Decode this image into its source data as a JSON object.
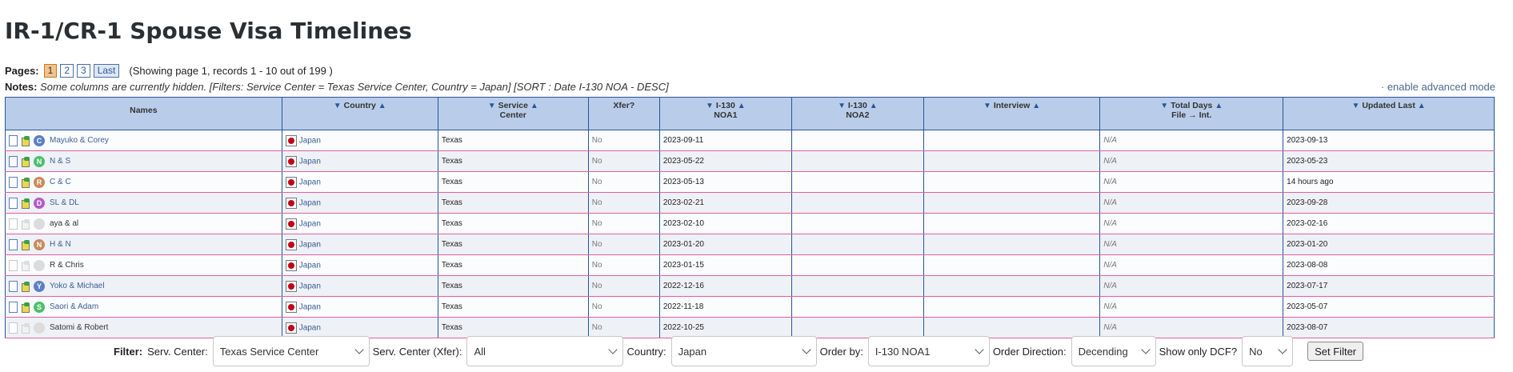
{
  "title": "IR-1/CR-1 Spouse Visa Timelines",
  "pager": {
    "label": "Pages:",
    "pages": [
      "1",
      "2",
      "3"
    ],
    "last": "Last",
    "info": "(Showing page 1, records 1 - 10 out of 199 )"
  },
  "notes": {
    "label": "Notes:",
    "text": "Some columns are currently hidden. [Filters: Service Center = Texas Service Center, Country = Japan] [SORT : Date I-130 NOA - DESC]"
  },
  "advanced_link": "· enable advanced mode",
  "columns": {
    "names": "Names",
    "country": "Country",
    "service_center_1": "Service",
    "service_center_2": "Center",
    "xfer": "Xfer?",
    "i130_noa1_1": "I-130",
    "i130_noa1_2": "NOA1",
    "i130_noa2_1": "I-130",
    "i130_noa2_2": "NOA2",
    "interview": "Interview",
    "total_days_1": "Total Days",
    "total_days_2": "File → Int.",
    "updated_last": "Updated Last"
  },
  "rows": [
    {
      "initial": "C",
      "avatar_color": "#5b7fc7",
      "name": "Mayuko & Corey",
      "active": true,
      "country": "Japan",
      "service_center": "Texas",
      "xfer": "No",
      "noa1": "2023-09-11",
      "noa2": "",
      "interview": "",
      "total_days": "N/A",
      "updated": "2023-09-13"
    },
    {
      "initial": "N",
      "avatar_color": "#4cbf6a",
      "name": "N & S",
      "active": true,
      "country": "Japan",
      "service_center": "Texas",
      "xfer": "No",
      "noa1": "2023-05-22",
      "noa2": "",
      "interview": "",
      "total_days": "N/A",
      "updated": "2023-05-23"
    },
    {
      "initial": "R",
      "avatar_color": "#c98a5a",
      "name": "C & C",
      "active": true,
      "country": "Japan",
      "service_center": "Texas",
      "xfer": "No",
      "noa1": "2023-05-13",
      "noa2": "",
      "interview": "",
      "total_days": "N/A",
      "updated": "14 hours ago"
    },
    {
      "initial": "D",
      "avatar_color": "#b45cc7",
      "name": "SL & DL",
      "active": true,
      "country": "Japan",
      "service_center": "Texas",
      "xfer": "No",
      "noa1": "2023-02-21",
      "noa2": "",
      "interview": "",
      "total_days": "N/A",
      "updated": "2023-09-28"
    },
    {
      "initial": "",
      "avatar_color": "",
      "name": "aya & al",
      "active": false,
      "country": "Japan",
      "service_center": "Texas",
      "xfer": "No",
      "noa1": "2023-02-10",
      "noa2": "",
      "interview": "",
      "total_days": "N/A",
      "updated": "2023-02-16"
    },
    {
      "initial": "N",
      "avatar_color": "#c98a5a",
      "name": "H & N",
      "active": true,
      "country": "Japan",
      "service_center": "Texas",
      "xfer": "No",
      "noa1": "2023-01-20",
      "noa2": "",
      "interview": "",
      "total_days": "N/A",
      "updated": "2023-01-20"
    },
    {
      "initial": "",
      "avatar_color": "",
      "name": "R & Chris",
      "active": false,
      "country": "Japan",
      "service_center": "Texas",
      "xfer": "No",
      "noa1": "2023-01-15",
      "noa2": "",
      "interview": "",
      "total_days": "N/A",
      "updated": "2023-08-08"
    },
    {
      "initial": "Y",
      "avatar_color": "#5b7fc7",
      "name": "Yoko & Michael",
      "active": true,
      "country": "Japan",
      "service_center": "Texas",
      "xfer": "No",
      "noa1": "2022-12-16",
      "noa2": "",
      "interview": "",
      "total_days": "N/A",
      "updated": "2023-07-17"
    },
    {
      "initial": "S",
      "avatar_color": "#4cbf6a",
      "name": "Saori & Adam",
      "active": true,
      "country": "Japan",
      "service_center": "Texas",
      "xfer": "No",
      "noa1": "2022-11-18",
      "noa2": "",
      "interview": "",
      "total_days": "N/A",
      "updated": "2023-05-07"
    },
    {
      "initial": "",
      "avatar_color": "",
      "name": "Satomi & Robert",
      "active": false,
      "country": "Japan",
      "service_center": "Texas",
      "xfer": "No",
      "noa1": "2022-10-25",
      "noa2": "",
      "interview": "",
      "total_days": "N/A",
      "updated": "2023-08-07"
    }
  ],
  "filter": {
    "label": "Filter:",
    "serv_center_label": "Serv. Center:",
    "serv_center_value": "Texas Service Center",
    "serv_center_xfer_label": "Serv. Center (Xfer):",
    "serv_center_xfer_value": "All",
    "country_label": "Country:",
    "country_value": "Japan",
    "order_by_label": "Order by:",
    "order_by_value": "I-130 NOA1",
    "order_dir_label": "Order Direction:",
    "order_dir_value": "Decending",
    "dcf_label": "Show only DCF?",
    "dcf_value": "No",
    "submit_label": "Set Filter"
  }
}
